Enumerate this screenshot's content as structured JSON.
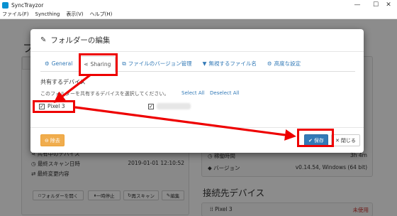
{
  "window": {
    "title": "SyncTrayzor",
    "controls": {
      "minimize": "—",
      "maximize": "☐",
      "close": "✕"
    }
  },
  "menubar": {
    "items": [
      "ファイル(F)",
      "Syncthing",
      "表示(V)",
      "ヘルプ(H)"
    ]
  },
  "background": {
    "folders_heading": "フォ",
    "devices_heading": "接続先デバイス",
    "folder_rows": [
      {
        "label": "共有中のデバイス",
        "value": ""
      },
      {
        "label": "最終スキャン日時",
        "value": "2019-01-01 12:10:52"
      },
      {
        "label": "最終変更内容",
        "value": ""
      }
    ],
    "device_stats": [
      {
        "label": "稼働時間",
        "value": "3h 4m"
      },
      {
        "label": "バージョン",
        "value": "v0.14.54, Windows (64 bit)"
      }
    ],
    "folder_buttons": [
      "フォルダーを開く",
      "一時停止",
      "再スキャン",
      "編集"
    ],
    "device_row_label": "Pixel 3",
    "device_row_status": "未使用"
  },
  "modal": {
    "title": "フォルダーの編集",
    "tabs": [
      {
        "label": "General",
        "icon": "gear-icon",
        "glyph": "⚙"
      },
      {
        "label": "Sharing",
        "icon": "share-icon",
        "glyph": "⋖"
      },
      {
        "label": "ファイルのバージョン管理",
        "icon": "copy-icon",
        "glyph": "⧉"
      },
      {
        "label": "無視するファイル名",
        "icon": "filter-icon",
        "glyph": "▼"
      },
      {
        "label": "高度な設定",
        "icon": "cogs-icon",
        "glyph": "⚙"
      }
    ],
    "active_tab": "Sharing",
    "sharing": {
      "section_label": "共有するデバイス",
      "description": "このフォルダーを共有するデバイスを選択してください。",
      "select_all": "Select All",
      "deselect_all": "Deselect All",
      "devices": [
        {
          "name": "Pixel 3",
          "checked": true
        },
        {
          "name": "",
          "checked": true
        }
      ]
    },
    "footer": {
      "remove_label": "除去",
      "save_label": "保存",
      "close_label": "閉じる"
    }
  },
  "colors": {
    "annotation": "#ee0000",
    "link": "#337ab7",
    "save": "#337ab7",
    "remove": "#f0ad4e"
  }
}
